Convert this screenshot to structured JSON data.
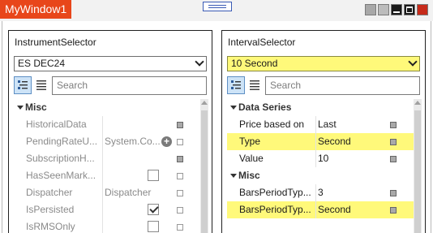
{
  "window": {
    "title": "MyWindow1",
    "buttons": [
      {
        "name": "window-option-1",
        "color": "#a8a8a8"
      },
      {
        "name": "window-option-2",
        "color": "#bcbcbc"
      },
      {
        "name": "window-minimize",
        "color": "#1a1a1a"
      },
      {
        "name": "window-maximize",
        "color": "#1a1a1a"
      },
      {
        "name": "window-close",
        "color": "#c62a1a"
      }
    ]
  },
  "left_panel": {
    "title": "InstrumentSelector",
    "dropdown_value": "ES DEC24",
    "search_placeholder": "Search",
    "category": "Misc",
    "rows": [
      {
        "label": "HistoricalData",
        "value": "",
        "control": "marker"
      },
      {
        "label": "PendingRateU...",
        "value": "System.Co...",
        "control": "plus-marker"
      },
      {
        "label": "SubscriptionH...",
        "value": "",
        "control": "marker"
      },
      {
        "label": "HasSeenMark...",
        "value": "",
        "control": "checkbox",
        "checked": false
      },
      {
        "label": "Dispatcher",
        "value": "Dispatcher",
        "control": "marker-empty"
      },
      {
        "label": "IsPersisted",
        "value": "",
        "control": "checkbox",
        "checked": true
      },
      {
        "label": "IsRMSOnly",
        "value": "",
        "control": "checkbox",
        "checked": false
      }
    ]
  },
  "right_panel": {
    "title": "IntervalSelector",
    "dropdown_value": "10 Second",
    "search_placeholder": "Search",
    "categories": [
      "Data Series",
      "Misc"
    ],
    "data_series_rows": [
      {
        "label": "Price based on",
        "value": "Last"
      },
      {
        "label": "Type",
        "value": "Second",
        "highlighted": true
      },
      {
        "label": "Value",
        "value": "10"
      }
    ],
    "misc_rows": [
      {
        "label": "BarsPeriodTyp...",
        "value": "3"
      },
      {
        "label": "BarsPeriodTyp...",
        "value": "Second",
        "highlighted": true
      }
    ],
    "highlight_color": "#fff97a"
  }
}
